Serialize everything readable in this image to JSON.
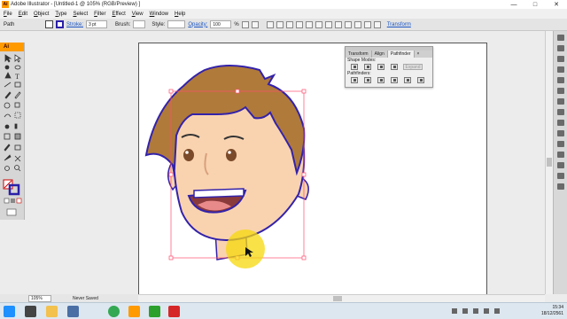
{
  "window": {
    "title": "Adobe Illustrator - [Untitled-1 @ 105% (RGB/Preview) ]",
    "app_icon": "Ai",
    "controls": [
      "—",
      "□",
      "✕"
    ]
  },
  "menubar": {
    "items": [
      {
        "label": "File",
        "mnemonic": "F",
        "rest": "ile"
      },
      {
        "label": "Edit",
        "mnemonic": "E",
        "rest": "dit"
      },
      {
        "label": "Object",
        "mnemonic": "O",
        "rest": "bject"
      },
      {
        "label": "Type",
        "mnemonic": "T",
        "rest": "ype"
      },
      {
        "label": "Select",
        "mnemonic": "S",
        "rest": "elect"
      },
      {
        "label": "Filter",
        "mnemonic": "F",
        "rest": "ilter"
      },
      {
        "label": "Effect",
        "mnemonic": "E",
        "rest": "ffect"
      },
      {
        "label": "View",
        "mnemonic": "V",
        "rest": "iew"
      },
      {
        "label": "Window",
        "mnemonic": "W",
        "rest": "indow"
      },
      {
        "label": "Help",
        "mnemonic": "H",
        "rest": "elp"
      }
    ]
  },
  "controlbar": {
    "selection_label": "Path",
    "stroke_label": "Stroke:",
    "stroke_weight": "3 pt",
    "brush_label": "Brush:",
    "style_label": "Style:",
    "opacity_label": "Opacity:",
    "opacity_value": "100",
    "opacity_unit": "%",
    "transform_label": "Transform",
    "fill_color": "#ffffff",
    "stroke_color": "#2b1fa8"
  },
  "toolbox": {
    "header": "Ai",
    "tools": [
      "selection-icon",
      "direct-selection-icon",
      "magic-wand-icon",
      "lasso-icon",
      "pen-icon",
      "type-icon",
      "line-icon",
      "rectangle-icon",
      "paintbrush-icon",
      "pencil-icon",
      "rotate-icon",
      "scale-icon",
      "warp-icon",
      "free-transform-icon",
      "symbol-sprayer-icon",
      "graph-icon",
      "mesh-icon",
      "gradient-icon",
      "eyedropper-icon",
      "blend-icon",
      "live-paint-icon",
      "scissors-icon",
      "hand-icon",
      "zoom-icon"
    ]
  },
  "pathfinder_panel": {
    "tabs": [
      {
        "label": "Transform",
        "active": false
      },
      {
        "label": "Align",
        "active": false
      },
      {
        "label": "Pathfinder",
        "active": true
      }
    ],
    "close_glyph": "×",
    "shape_modes_label": "Shape Modes:",
    "expand_label": "Expand",
    "pathfinders_label": "Pathfinders:"
  },
  "statusbar": {
    "zoom": "105%",
    "status": "Never Saved"
  },
  "taskbar": {
    "time": "15:34",
    "date": "18/12/2561",
    "apps": [
      {
        "name": "start-button",
        "color": "#1e90ff"
      },
      {
        "name": "search-app",
        "color": "#444444"
      },
      {
        "name": "explorer-app",
        "color": "#f2c14e"
      },
      {
        "name": "file-app",
        "color": "#4a6fa5"
      },
      {
        "name": "chrome-app",
        "color": "#34a853"
      },
      {
        "name": "illustrator-app",
        "color": "#ff9a00"
      },
      {
        "name": "camtasia-app",
        "color": "#2ca02c"
      },
      {
        "name": "recorder-app",
        "color": "#d62728"
      }
    ]
  },
  "artwork": {
    "hair_color": "#b07a3a",
    "skin_color": "#f9d3b0",
    "outline_color": "#3322aa",
    "mouth_color": "#8a3a3a",
    "tongue_color": "#e98a8a",
    "selection_color": "#ff4d6d",
    "cursor_highlight_color": "#f5d80a"
  }
}
